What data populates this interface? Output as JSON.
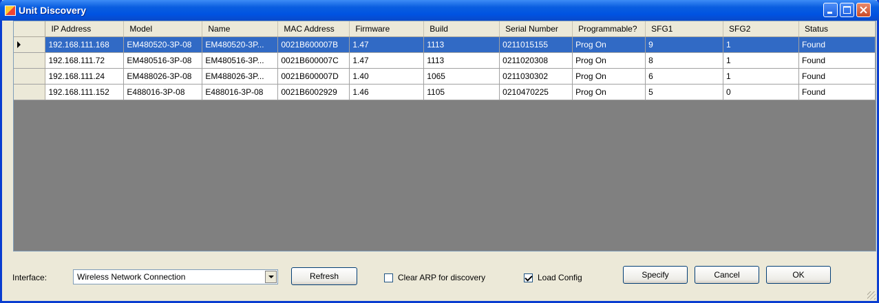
{
  "window": {
    "title": "Unit Discovery"
  },
  "grid": {
    "columns": [
      "IP Address",
      "Model",
      "Name",
      "MAC Address",
      "Firmware",
      "Build",
      "Serial Number",
      "Programmable?",
      "SFG1",
      "SFG2",
      "Status"
    ],
    "rows": [
      [
        "192.168.111.168",
        "EM480520-3P-08",
        "EM480520-3P...",
        "0021B600007B",
        "1.47",
        "1113",
        "0211015155",
        "Prog On",
        "9",
        "1",
        "Found"
      ],
      [
        "192.168.111.72",
        "EM480516-3P-08",
        "EM480516-3P...",
        "0021B600007C",
        "1.47",
        "1113",
        "0211020308",
        "Prog On",
        "8",
        "1",
        "Found"
      ],
      [
        "192.168.111.24",
        "EM488026-3P-08",
        "EM488026-3P...",
        "0021B600007D",
        "1.40",
        "1065",
        "0211030302",
        "Prog On",
        "6",
        "1",
        "Found"
      ],
      [
        "192.168.111.152",
        "E488016-3P-08",
        "E488016-3P-08",
        "0021B6002929",
        "1.46",
        "1105",
        "0210470225",
        "Prog On",
        "5",
        "0",
        "Found"
      ]
    ]
  },
  "bottom": {
    "interface_label": "Interface:",
    "interface_value": "Wireless Network Connection",
    "refresh_label": "Refresh",
    "clear_arp_label": "Clear ARP for discovery",
    "clear_arp_checked": false,
    "load_config_label": "Load Config",
    "load_config_checked": true,
    "specify_label": "Specify",
    "cancel_label": "Cancel",
    "ok_label": "OK"
  }
}
